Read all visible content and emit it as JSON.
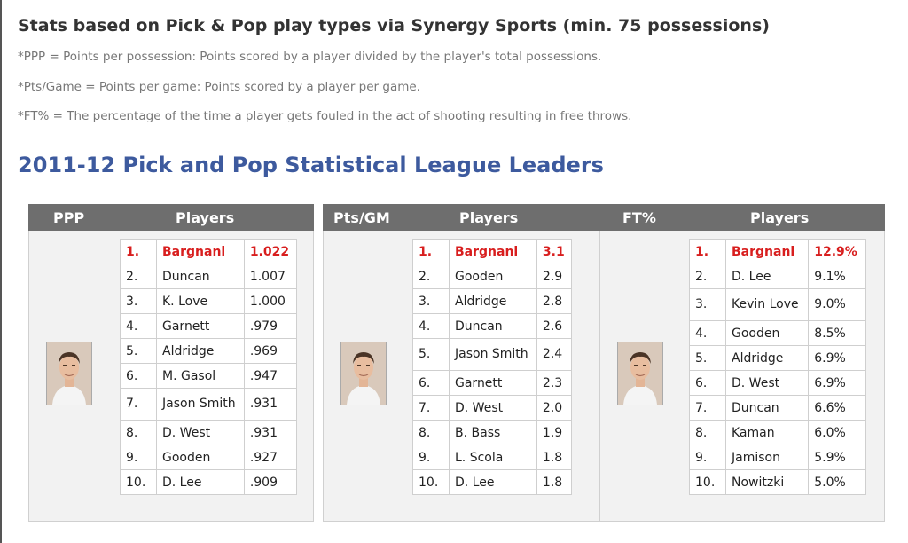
{
  "header": {
    "title": "Stats based on Pick & Pop play types via Synergy Sports (min. 75 possessions)",
    "notes": [
      "*PPP = Points per possession: Points scored by a player divided by the player's total possessions.",
      "*Pts/Game = Points per game: Points scored by a player per game.",
      "*FT% = The percentage of the time a player gets fouled in the act of shooting resulting in free throws."
    ]
  },
  "section_title": "2011-12 Pick and Pop Statistical League Leaders",
  "colors": {
    "accent": "#3d5a9e",
    "leader": "#d81e1e",
    "header_bg": "#6e6e6e"
  },
  "tables": [
    {
      "stat_label": "PPP",
      "players_label": "Players",
      "rows": [
        {
          "rank": "1.",
          "name": "Bargnani",
          "value": "1.022"
        },
        {
          "rank": "2.",
          "name": "Duncan",
          "value": "1.007"
        },
        {
          "rank": "3.",
          "name": "K. Love",
          "value": "1.000"
        },
        {
          "rank": "4.",
          "name": "Garnett",
          "value": ".979"
        },
        {
          "rank": "5.",
          "name": "Aldridge",
          "value": ".969"
        },
        {
          "rank": "6.",
          "name": "M. Gasol",
          "value": ".947"
        },
        {
          "rank": "7.",
          "name": "Jason Smith",
          "value": ".931"
        },
        {
          "rank": "8.",
          "name": "D. West",
          "value": ".931"
        },
        {
          "rank": "9.",
          "name": "Gooden",
          "value": ".927"
        },
        {
          "rank": "10.",
          "name": "D. Lee",
          "value": ".909"
        }
      ]
    },
    {
      "stat_label": "Pts/GM",
      "players_label": "Players",
      "rows": [
        {
          "rank": "1.",
          "name": "Bargnani",
          "value": "3.1"
        },
        {
          "rank": "2.",
          "name": "Gooden",
          "value": "2.9"
        },
        {
          "rank": "3.",
          "name": "Aldridge",
          "value": "2.8"
        },
        {
          "rank": "4.",
          "name": "Duncan",
          "value": "2.6"
        },
        {
          "rank": "5.",
          "name": "Jason Smith",
          "value": "2.4"
        },
        {
          "rank": "6.",
          "name": "Garnett",
          "value": "2.3"
        },
        {
          "rank": "7.",
          "name": "D. West",
          "value": "2.0"
        },
        {
          "rank": "8.",
          "name": "B. Bass",
          "value": "1.9"
        },
        {
          "rank": "9.",
          "name": "L. Scola",
          "value": "1.8"
        },
        {
          "rank": "10.",
          "name": "D. Lee",
          "value": "1.8"
        }
      ]
    },
    {
      "stat_label": "FT%",
      "players_label": "Players",
      "rows": [
        {
          "rank": "1.",
          "name": "Bargnani",
          "value": "12.9%"
        },
        {
          "rank": "2.",
          "name": "D. Lee",
          "value": "9.1%"
        },
        {
          "rank": "3.",
          "name": "Kevin Love",
          "value": "9.0%"
        },
        {
          "rank": "4.",
          "name": "Gooden",
          "value": "8.5%"
        },
        {
          "rank": "5.",
          "name": "Aldridge",
          "value": "6.9%"
        },
        {
          "rank": "6.",
          "name": "D. West",
          "value": "6.9%"
        },
        {
          "rank": "7.",
          "name": "Duncan",
          "value": "6.6%"
        },
        {
          "rank": "8.",
          "name": "Kaman",
          "value": "6.0%"
        },
        {
          "rank": "9.",
          "name": "Jamison",
          "value": "5.9%"
        },
        {
          "rank": "10.",
          "name": "Nowitzki",
          "value": "5.0%"
        }
      ]
    }
  ]
}
